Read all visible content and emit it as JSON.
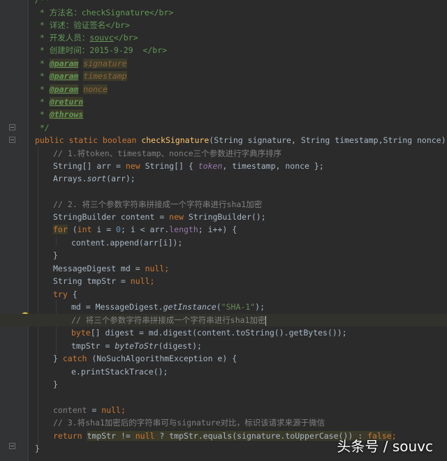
{
  "editor": {
    "doc": {
      "open": "/**",
      "l1": " * 方法名：checkSignature</br>",
      "l2": " * 详述：验证签名</br>",
      "l3_a": " * 开发人员：",
      "l3_link": "souvc",
      "l3_b": "</br>",
      "l4": " * 创建时间：2015-9-29  </br>",
      "p1_tag": "@param",
      "p1_val": "signature",
      "p2_tag": "@param",
      "p2_val": "timestamp",
      "p3_tag": "@param",
      "p3_val": "nonce",
      "ret_tag": "@return",
      "thr_tag": "@throws",
      "close": " */"
    },
    "code": {
      "sig_kw": "public static boolean ",
      "sig_fn": "checkSignature",
      "sig_rest": "(String signature, String timestamp,String nonce) {",
      "c1": "// 1.将token、timestamp、nonce三个参数进行字典序排序",
      "arr_a": "String[] arr = ",
      "arr_new": "new ",
      "arr_b": "String[] { ",
      "arr_token": "token",
      "arr_c": ", timestamp, nonce };",
      "sort_a": "Arrays.",
      "sort_fn": "sort",
      "sort_b": "(arr);",
      "c2": "// 2. 将三个参数字符串拼接成一个字符串进行sha1加密",
      "sb_a": "StringBuilder content = ",
      "sb_new": "new ",
      "sb_b": "StringBuilder();",
      "for_kw": "for",
      "for_a": " (",
      "for_int": "int ",
      "for_b": "i = ",
      "for_zero": "0",
      "for_c": "; i < arr.",
      "for_len": "length",
      "for_d": "; i++) {",
      "append": "content.append(arr[i]);",
      "rb1": "}",
      "md_a": "MessageDigest md = ",
      "md_null": "null",
      "md_b": ";",
      "ts_a": "String tmpStr = ",
      "ts_null": "null",
      "ts_b": ";",
      "try": "try",
      "try_b": " {",
      "gi_a": "md = MessageDigest.",
      "gi_fn": "getInstance",
      "gi_b": "(",
      "gi_str": "\"SHA-1\"",
      "gi_c": ");",
      "c3": "// 将三个参数字符串拼接成一个字符串进行sha1加密",
      "dg_kw": "byte",
      "dg_a": "[] digest = md.digest(content.toString().getBytes());",
      "tb_a": "tmpStr = ",
      "tb_fn": "byteToStr",
      "tb_b": "(digest);",
      "catch_a": "} ",
      "catch_kw": "catch",
      "catch_b": " (NoSuchAlgorithmException e) {",
      "pst": "e.printStackTrace();",
      "rb2": "}",
      "cn_a": "content",
      "cn_b": " = ",
      "cn_null": "null",
      "cn_c": ";",
      "c4": "// 3.将sha1加密后的字符串可与signature对比，标识该请求来源于微信",
      "ret_kw": "return ",
      "ret_a": "tmpStr",
      "ret_b": " != ",
      "ret_null": "null",
      "ret_c": " ? tmpStr.equals(signature.toUpperCase()) : ",
      "ret_false": "false",
      "ret_d": ";",
      "rb3": "}"
    }
  },
  "watermark": "头条号 / souvc"
}
